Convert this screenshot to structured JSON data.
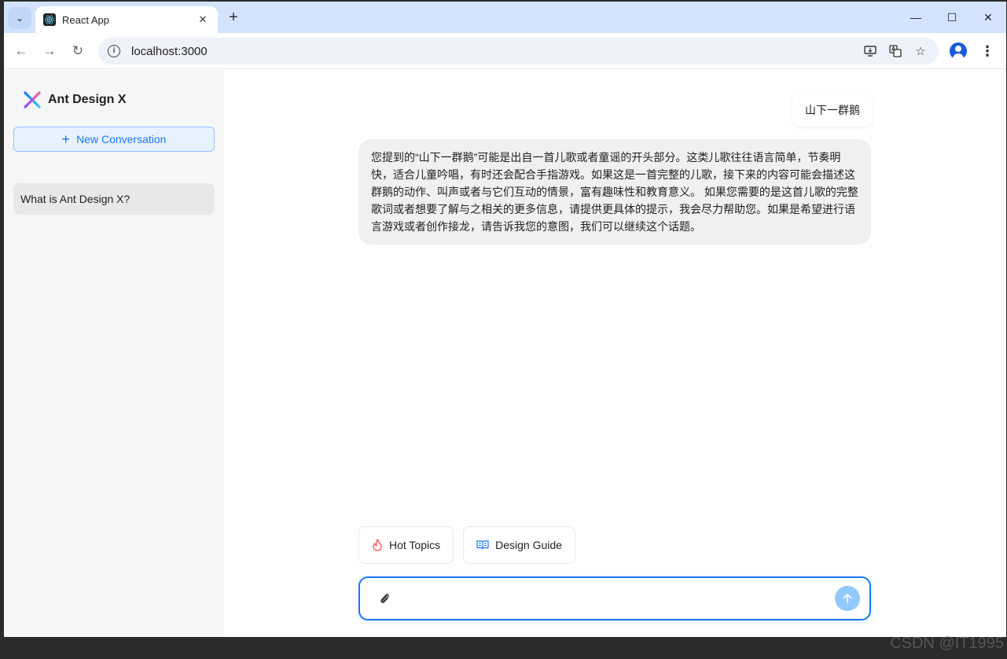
{
  "browser": {
    "tab_title": "React App",
    "url": "localhost:3000",
    "tab_search_glyph": "⌄",
    "new_tab_glyph": "+",
    "close_glyph": "✕",
    "minimize_glyph": "—",
    "maximize_glyph": "☐",
    "window_close_glyph": "✕",
    "back_glyph": "←",
    "forward_glyph": "→",
    "reload_glyph": "↻",
    "menu_glyph": "⋮",
    "star_glyph": "☆"
  },
  "sidebar": {
    "logo_text": "Ant Design X",
    "new_conversation_label": "New Conversation",
    "conversations": [
      {
        "label": "What is Ant Design X?"
      }
    ]
  },
  "chat": {
    "messages": [
      {
        "role": "user",
        "text": "山下一群鹅"
      },
      {
        "role": "ai",
        "text": "您提到的“山下一群鹅”可能是出自一首儿歌或者童谣的开头部分。这类儿歌往往语言简单，节奏明快，适合儿童吟唱，有时还会配合手指游戏。如果这是一首完整的儿歌，接下来的内容可能会描述这群鹅的动作、叫声或者与它们互动的情景，富有趣味性和教育意义。 如果您需要的是这首儿歌的完整歌词或者想要了解与之相关的更多信息，请提供更具体的提示，我会尽力帮助您。如果是希望进行语言游戏或者创作接龙，请告诉我您的意图，我们可以继续这个话题。"
      }
    ]
  },
  "prompts": [
    {
      "label": "Hot Topics",
      "icon": "fire-icon"
    },
    {
      "label": "Design Guide",
      "icon": "book-icon"
    }
  ],
  "sender": {
    "value": "",
    "placeholder": ""
  },
  "colors": {
    "primary": "#1677ff",
    "send_disabled": "#91caff",
    "hot_icon": "#ff4d4f",
    "guide_icon": "#1677ff"
  },
  "watermark": "CSDN @IT1995"
}
